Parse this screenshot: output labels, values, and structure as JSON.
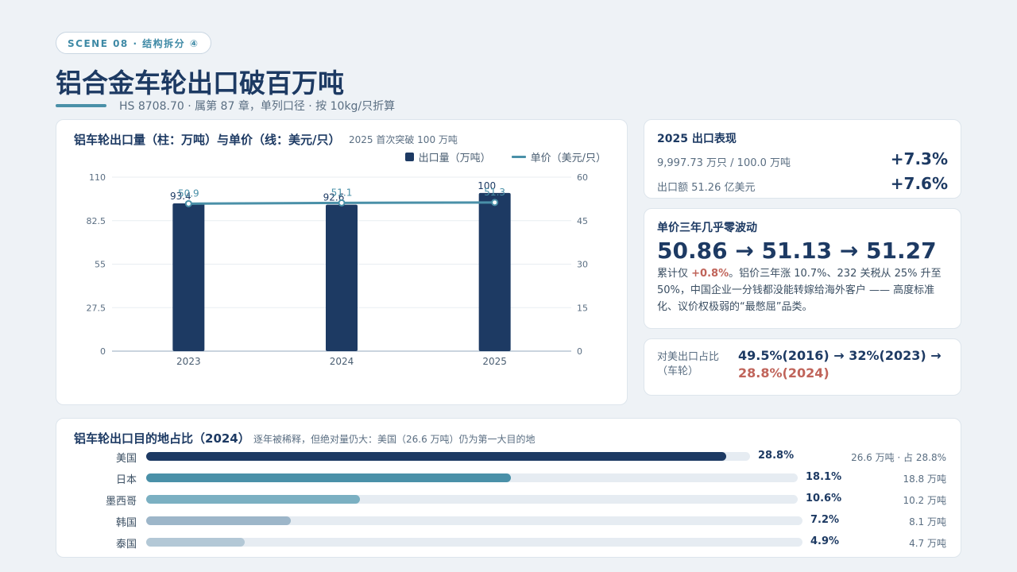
{
  "header": {
    "scene_tag": "SCENE 08 · 结构拆分 ④",
    "title": "铝合金车轮出口破百万吨",
    "subtitle": "HS 8708.70 · 属第 87 章，单列口径 · 按 10kg/只折算"
  },
  "chart_card": {
    "title": "铝车轮出口量（柱：万吨）与单价（线：美元/只）",
    "note": "2025 首次突破 100 万吨",
    "legend_bar": "出口量（万吨）",
    "legend_line": "单价（美元/只）"
  },
  "chart_data": {
    "type": "bar",
    "categories": [
      "2023",
      "2024",
      "2025"
    ],
    "series": [
      {
        "name": "出口量（万吨）",
        "type": "bar",
        "axis": "left",
        "values": [
          93.4,
          92.6,
          100
        ],
        "labels": [
          "93.4",
          "92.6",
          "100"
        ]
      },
      {
        "name": "单价（美元/只）",
        "type": "line",
        "axis": "right",
        "values": [
          50.86,
          51.13,
          51.27
        ],
        "labels": [
          "50.9",
          "51.1",
          "51.3"
        ]
      }
    ],
    "ylim_left": [
      0,
      110
    ],
    "ylim_right": [
      0,
      60
    ],
    "left_ticks": [
      "0",
      "27.5",
      "55",
      "82.5",
      "110"
    ],
    "right_ticks": [
      "0",
      "15",
      "30",
      "45",
      "60"
    ],
    "grid": true,
    "legend_position": "top-right",
    "colors": {
      "bar": "#1d3a63",
      "line": "#4a90a8"
    }
  },
  "export_card": {
    "title": "2025 出口表现",
    "row1_label": "9,997.73 万只 / 100.0 万吨",
    "row1_value": "+7.3%",
    "row2_label": "出口额 51.26 亿美元",
    "row2_value": "+7.6%"
  },
  "price_card": {
    "title": "单价三年几乎零波动",
    "path": "50.86 → 51.13 → 51.27",
    "desc_prefix": "累计仅 ",
    "desc_highlight": "+0.8%",
    "desc_rest": "。铝价三年涨 10.7%、232 关税从 25% 升至 50%，中国企业一分钱都没能转嫁给海外客户 —— 高度标准化、议价权极弱的“最憋屈”品类。"
  },
  "share_card": {
    "label": "对美出口占比（车轮）",
    "part1": "49.5%(2016) → 32%(2023) →",
    "part2": "28.8%(2024)"
  },
  "destinations": {
    "title": "铝车轮出口目的地占比（2024）",
    "note": "逐年被稀释，但绝对量仍大：美国（26.6 万吨）仍为第一大目的地",
    "rows": [
      {
        "country": "美国",
        "pct": "28.8%",
        "value": 28.8,
        "amount": "26.6 万吨 · 占 28.8%",
        "color": "#1d3a63"
      },
      {
        "country": "日本",
        "pct": "18.1%",
        "value": 18.1,
        "amount": "18.8 万吨",
        "color": "#4a90a8"
      },
      {
        "country": "墨西哥",
        "pct": "10.6%",
        "value": 10.6,
        "amount": "10.2 万吨",
        "color": "#7bb0c2"
      },
      {
        "country": "韩国",
        "pct": "7.2%",
        "value": 7.2,
        "amount": "8.1 万吨",
        "color": "#9db6c9"
      },
      {
        "country": "泰国",
        "pct": "4.9%",
        "value": 4.9,
        "amount": "4.7 万吨",
        "color": "#b3c8d6"
      }
    ]
  }
}
